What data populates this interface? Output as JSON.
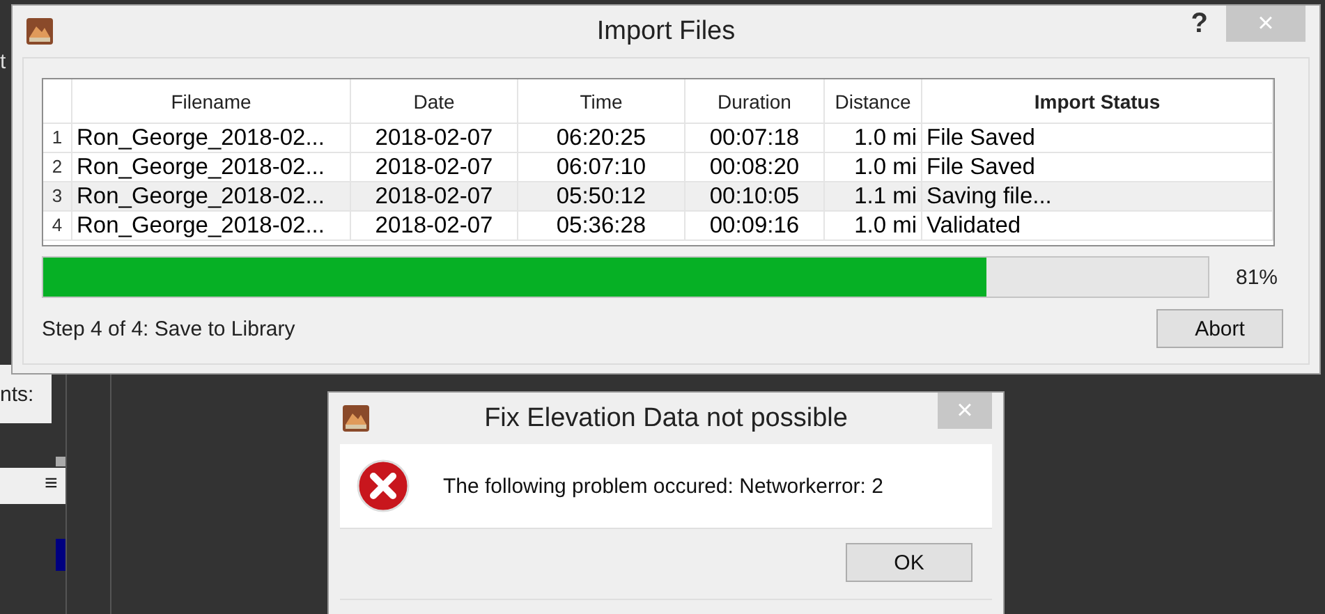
{
  "background": {
    "texts": [
      "t",
      "nts:"
    ],
    "menu_glyph": "≡"
  },
  "import_dialog": {
    "title": "Import Files",
    "help": "?",
    "close": "×",
    "table": {
      "columns": [
        {
          "label": "Filename",
          "emphasized": false
        },
        {
          "label": "Date",
          "emphasized": false
        },
        {
          "label": "Time",
          "emphasized": false
        },
        {
          "label": "Duration",
          "emphasized": false
        },
        {
          "label": "Distance",
          "emphasized": false
        },
        {
          "label": "Import Status",
          "emphasized": true
        }
      ],
      "rows": [
        {
          "number": "1",
          "cells": [
            "Ron_George_2018-02...",
            "2018-02-07",
            "06:20:25",
            "00:07:18",
            "1.0 mi",
            "File Saved"
          ],
          "selected": false
        },
        {
          "number": "2",
          "cells": [
            "Ron_George_2018-02...",
            "2018-02-07",
            "06:07:10",
            "00:08:20",
            "1.0 mi",
            "File Saved"
          ],
          "selected": false
        },
        {
          "number": "3",
          "cells": [
            "Ron_George_2018-02...",
            "2018-02-07",
            "05:50:12",
            "00:10:05",
            "1.1 mi",
            "Saving file..."
          ],
          "selected": true
        },
        {
          "number": "4",
          "cells": [
            "Ron_George_2018-02...",
            "2018-02-07",
            "05:36:28",
            "00:09:16",
            "1.0 mi",
            "Validated"
          ],
          "selected": false
        }
      ]
    },
    "progress": {
      "level": 0.81,
      "reading": "81%"
    },
    "step": "Step 4 of 4: Save to Library",
    "buttons": [
      "Abort"
    ]
  },
  "error_dialog": {
    "title": "Fix Elevation Data not possible",
    "close": "×",
    "message": "The following problem occured: Networkerror: 2",
    "buttons": [
      "OK"
    ]
  }
}
